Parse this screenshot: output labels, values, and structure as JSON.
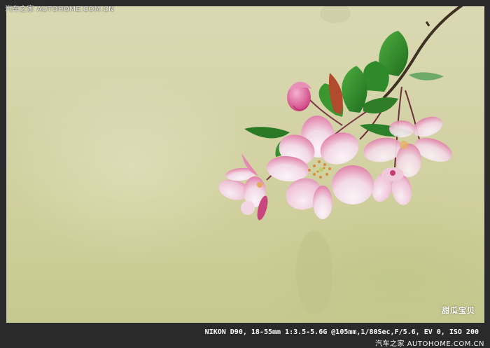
{
  "watermark": {
    "top": "汽车之家 AUTOHOME.COM.CN",
    "bottom": "汽车之家 AUTOHOME.COM.CN"
  },
  "photo": {
    "signature": "甜瓜宝贝",
    "exif": "NIKON D90, 18-55mm 1:3.5-5.6G @105mm,1/80Sec,F/5.6, EV 0, ISO 200",
    "subject": "crabapple-blossoms",
    "colors": {
      "background": "#d4d3a8",
      "frame": "#2a2a2a",
      "petal_pink": "#e889b0",
      "petal_white": "#f6eef3",
      "leaf_green": "#2f8a2a",
      "branch": "#4a3a2a"
    }
  }
}
